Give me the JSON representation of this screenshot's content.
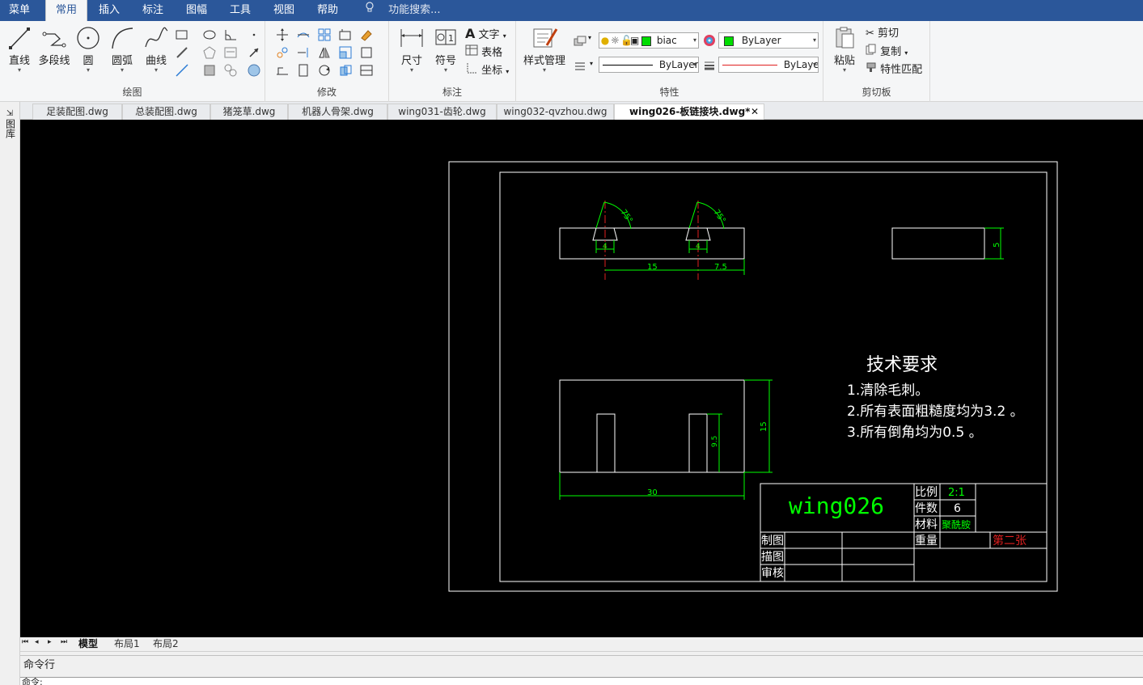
{
  "menu": {
    "items": [
      "菜单",
      "常用",
      "插入",
      "标注",
      "图幅",
      "工具",
      "视图",
      "帮助"
    ],
    "active_index": 1,
    "search_placeholder": "功能搜索..."
  },
  "ribbon": {
    "draw": {
      "label": "绘图",
      "line": "直线",
      "polyline": "多段线",
      "circle": "圆",
      "arc": "圆弧",
      "curve": "曲线"
    },
    "modify": {
      "label": "修改"
    },
    "annotation": {
      "label": "标注",
      "dimension": "尺寸",
      "symbol": "符号",
      "text": "文字",
      "table": "表格",
      "coordinate": "坐标"
    },
    "properties": {
      "label": "特性",
      "style_manager": "样式管理",
      "layer_name": "biac",
      "color_combo": "ByLayer",
      "linetype_combo": "ByLayer",
      "lineweight_combo": "ByLaye"
    },
    "clipboard": {
      "label": "剪切板",
      "paste": "粘贴",
      "cut": "剪切",
      "copy": "复制",
      "match": "特性匹配"
    }
  },
  "doc_tabs": [
    "足装配图.dwg",
    "总装配图.dwg",
    "猪笼草.dwg",
    "机器人骨架.dwg",
    "wing031-齿轮.dwg",
    "wing032-qvzhou.dwg",
    "wing026-板链接块.dwg*"
  ],
  "active_doc_index": 6,
  "left_strip_label": "图库",
  "drawing": {
    "tech_title": "技术要求",
    "tech_req": [
      "1.清除毛刺。",
      "2.所有表面粗糙度均为3.2 。",
      "3.所有倒角均为0.5 。"
    ],
    "dims": {
      "angle1": "75°",
      "angle2": "75°",
      "w1": "4",
      "w2": "4",
      "d15": "15",
      "d75": "7.5",
      "side5": "5",
      "h15": "15",
      "h95": "9.5",
      "w30": "30"
    },
    "title_block": {
      "name": "wing026",
      "scale_label": "比例",
      "scale_value": "2:1",
      "count_label": "件数",
      "count_value": "6",
      "material_label": "材料",
      "material_value": "聚酰胺",
      "drawn_label": "制图",
      "traced_label": "描图",
      "checked_label": "审核",
      "weight_label": "重量",
      "sheet_label": "第二张"
    }
  },
  "layout_tabs": [
    "模型",
    "布局1",
    "布局2"
  ],
  "command": {
    "label": "命令行",
    "prompt": "命令:"
  },
  "colors": {
    "menubar": "#2b579a",
    "canvas": "#000000",
    "dim_green": "#00ff00",
    "center_red": "#ff0000"
  }
}
